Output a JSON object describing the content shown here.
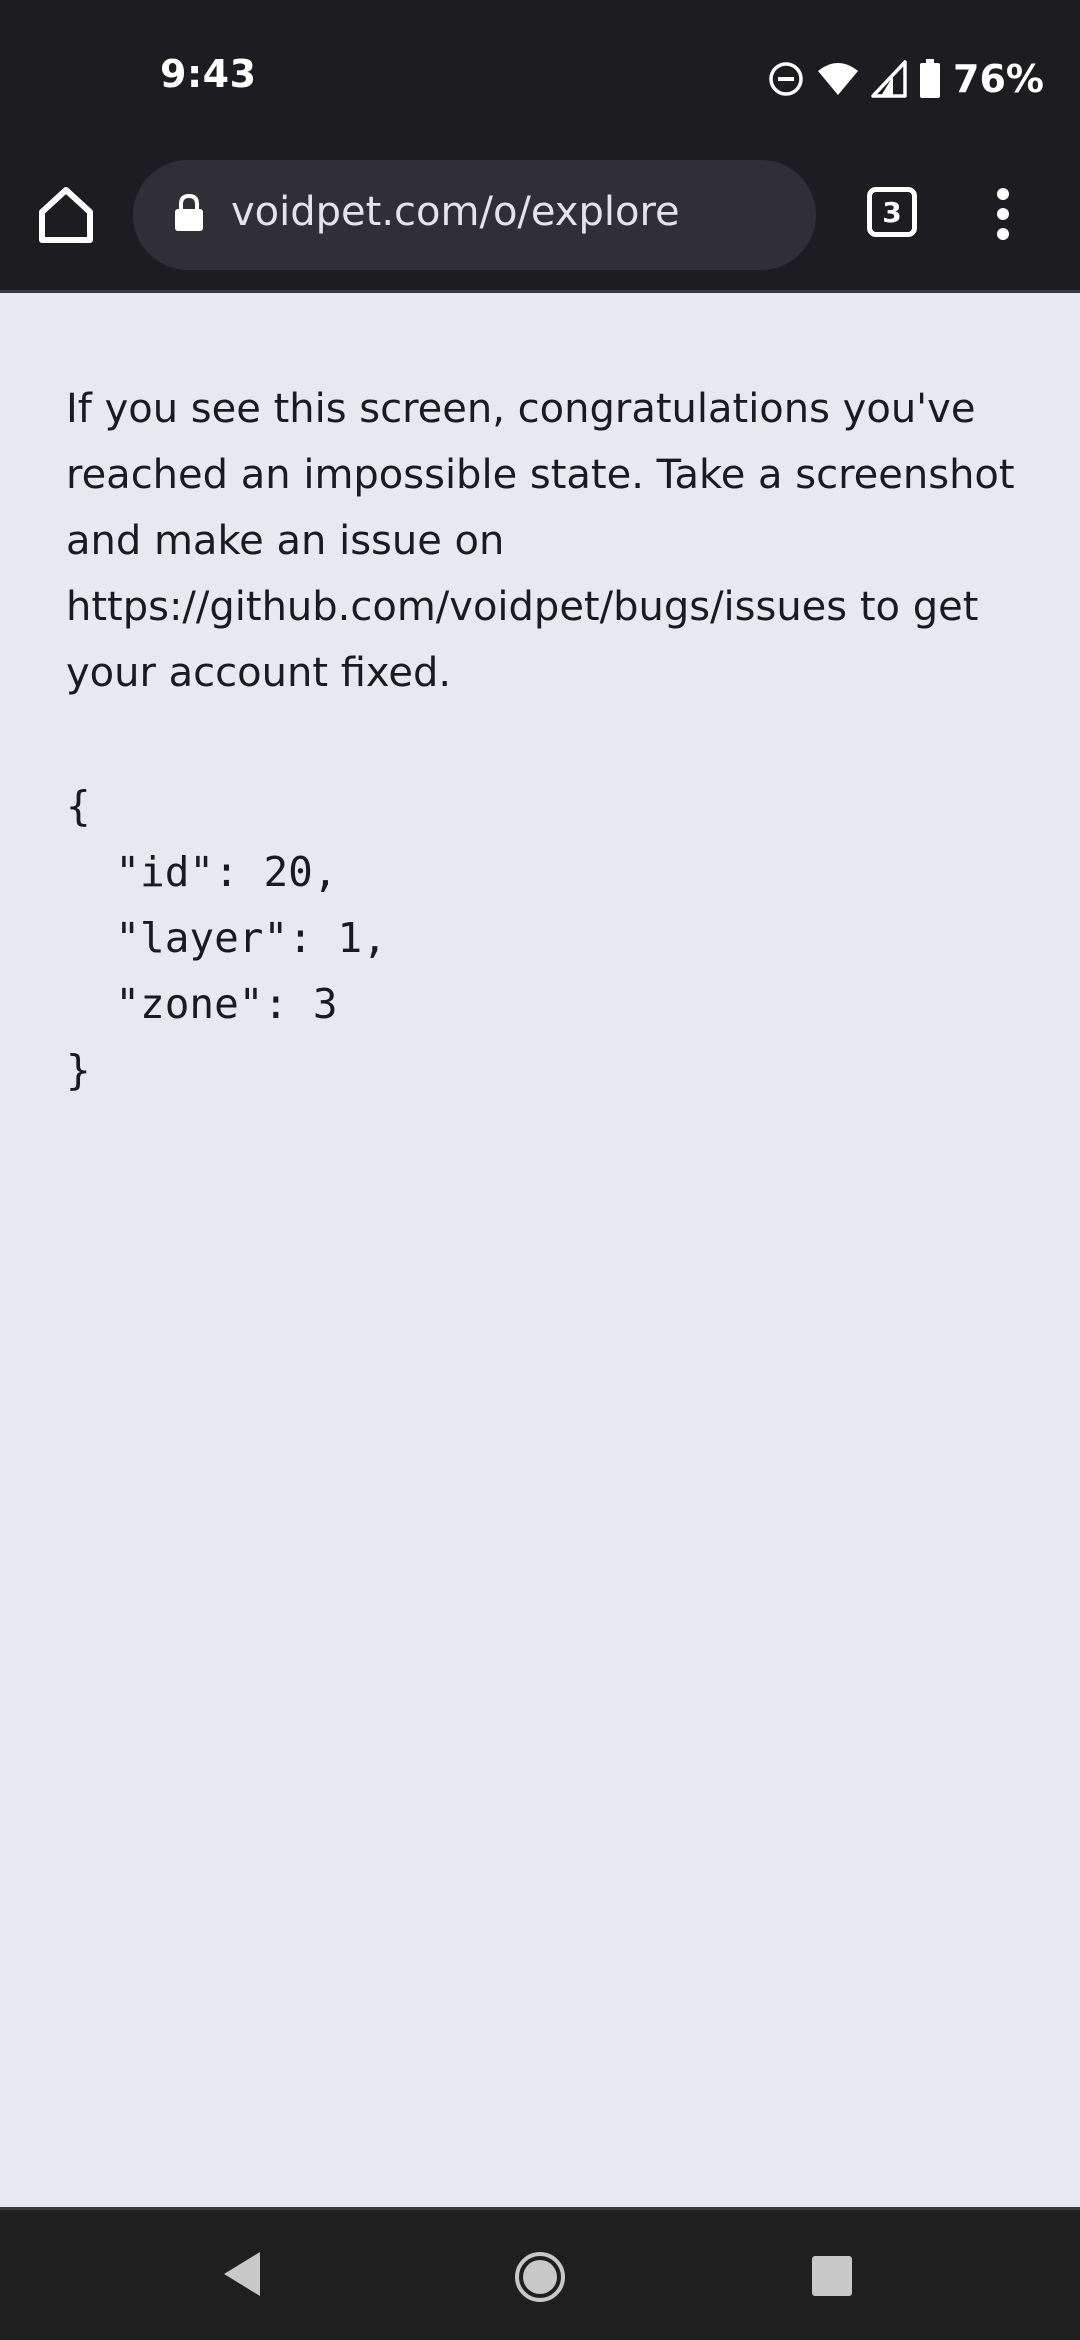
{
  "status_bar": {
    "time": "9:43",
    "battery_percent": "76%",
    "icons": [
      "do-not-disturb-icon",
      "wifi-icon",
      "cell-signal-icon",
      "battery-icon"
    ]
  },
  "browser": {
    "url": "voidpet.com/o/explore",
    "tab_count": "3",
    "icons": [
      "home-icon",
      "lock-icon",
      "more-vert-icon"
    ]
  },
  "page": {
    "message": "If you see this screen, congratulations you've reached an impossible state. Take a screenshot and make an issue on https://github.com/voidpet/bugs/issues to get your account fixed.",
    "json_text": "{\n  \"id\": 20,\n  \"layer\": 1,\n  \"zone\": 3\n}"
  },
  "nav_bar": {
    "icons": [
      "back-icon",
      "home-circle-icon",
      "recents-icon"
    ]
  },
  "colors": {
    "system_bar_bg": "#1d1c20",
    "url_bar_bg": "#302f36",
    "page_bg": "#e8e9ee",
    "text": "#1b1b1f"
  }
}
